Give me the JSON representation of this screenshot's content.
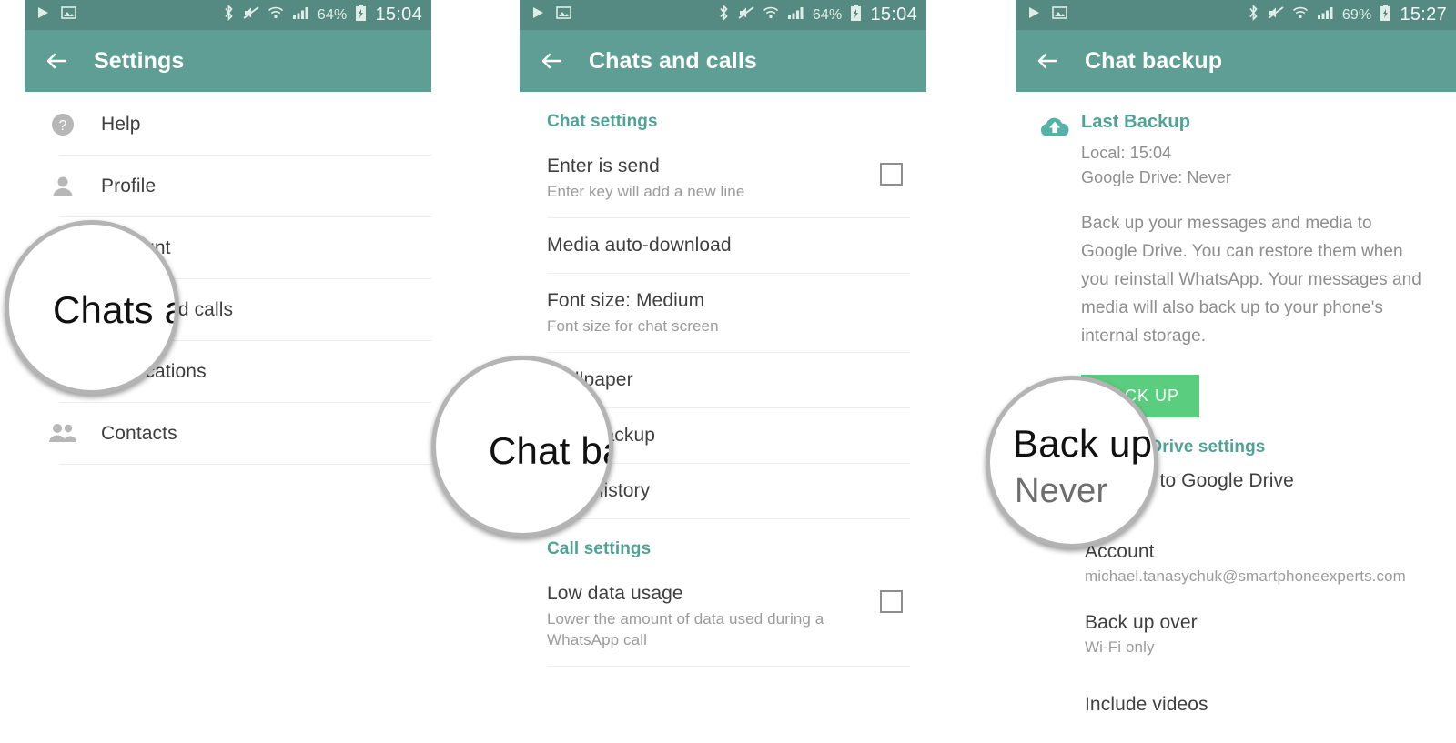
{
  "colors": {
    "appbar_teal": "#5f9e95",
    "statusbar_teal": "#558a83",
    "section_header_teal": "#4fa296",
    "backup_button_green": "#5bcd7e",
    "primary_text": "#3f3f3f",
    "secondary_text": "#9b9b9b",
    "divider": "#ececec"
  },
  "panel1": {
    "statusbar": {
      "icons": [
        "play-icon",
        "image-icon",
        "bluetooth-icon",
        "mute-icon",
        "wifi-icon",
        "signal-icon"
      ],
      "battery_percent": "64%",
      "battery_icon": "battery-charging-icon",
      "time": "15:04"
    },
    "appbar": {
      "back_icon": "back-arrow-icon",
      "title": "Settings"
    },
    "items": [
      {
        "icon": "help-icon",
        "label": "Help"
      },
      {
        "icon": "profile-icon",
        "label": "Profile"
      },
      {
        "icon": "account-icon",
        "label": "Account"
      },
      {
        "icon": "chats-icon",
        "label": "Chats and calls"
      },
      {
        "icon": "notifications-icon",
        "label": "Notifications"
      },
      {
        "icon": "contacts-icon",
        "label": "Contacts"
      }
    ],
    "magnifier": {
      "text": "Chats a"
    }
  },
  "panel2": {
    "statusbar": {
      "battery_percent": "64%",
      "time": "15:04"
    },
    "appbar": {
      "back_icon": "back-arrow-icon",
      "title": "Chats and calls"
    },
    "chat_settings_header": "Chat settings",
    "chat_settings": [
      {
        "title": "Enter is send",
        "subtitle": "Enter key will add a new line",
        "checkbox": true,
        "checked": false
      },
      {
        "title": "Media auto-download",
        "subtitle": "",
        "checkbox": false,
        "checked": false
      },
      {
        "title": "Font size: Medium",
        "subtitle": "Font size for chat screen",
        "checkbox": false,
        "checked": false
      },
      {
        "title": "Wallpaper",
        "subtitle": "",
        "checkbox": false,
        "checked": false
      },
      {
        "title": "Chat backup",
        "subtitle": "",
        "checkbox": false,
        "checked": false
      },
      {
        "title": "Chat history",
        "subtitle": "",
        "checkbox": false,
        "checked": false
      }
    ],
    "call_settings_header": "Call settings",
    "call_settings": [
      {
        "title": "Low data usage",
        "subtitle": "Lower the amount of data used during a WhatsApp call",
        "checkbox": true,
        "checked": false
      }
    ],
    "magnifier": {
      "text": "Chat ba"
    }
  },
  "panel3": {
    "statusbar": {
      "battery_percent": "69%",
      "time": "15:27"
    },
    "appbar": {
      "back_icon": "back-arrow-icon",
      "title": "Chat backup"
    },
    "last_backup": {
      "icon": "cloud-upload-icon",
      "title": "Last Backup",
      "local": "Local: 15:04",
      "drive": "Google Drive: Never",
      "description": "Back up your messages and media to Google Drive. You can restore them when you reinstall WhatsApp. Your messages and media will also back up to your phone's internal storage.",
      "button_label": "BACK UP"
    },
    "drive_settings_header": "Google Drive settings",
    "drive_items": [
      {
        "title": "Back up to Google Drive",
        "subtitle": "Never"
      },
      {
        "title": "Account",
        "subtitle": "michael.tanasychuk@smartphoneexperts.com"
      },
      {
        "title": "Back up over",
        "subtitle": "Wi-Fi only"
      },
      {
        "title": "Include videos",
        "subtitle": "",
        "checkbox": true,
        "checked": false
      }
    ],
    "magnifier": {
      "text": "Back up",
      "subtext": "Never"
    }
  }
}
